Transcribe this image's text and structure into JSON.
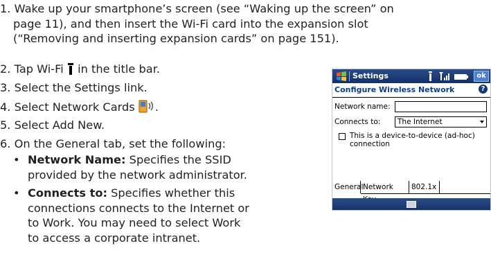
{
  "steps": [
    {
      "num": "1.",
      "text": "Wake up your smartphone’s screen (see “Waking up the screen” on",
      "line2": "page 11), and then insert the Wi-Fi card into the expansion slot",
      "line3": "(“Removing and inserting expansion cards” on page 151)."
    },
    {
      "num": "2.",
      "text_before": "Tap Wi-Fi",
      "text_after": "in the title bar.",
      "icon": "wifi-signal-icon"
    },
    {
      "num": "3.",
      "text": "Select the Settings link."
    },
    {
      "num": "4.",
      "text": "Select Network Cards",
      "icon": "network-cards-icon",
      "text_after": "."
    },
    {
      "num": "5.",
      "text": "Select Add New."
    },
    {
      "num": "6.",
      "text": "On the General tab, set the following:"
    }
  ],
  "bullets": [
    {
      "term": "Network Name:",
      "desc_l1": "Specifies the SSID",
      "desc_l2": "provided by the network administrator."
    },
    {
      "term": "Connects to:",
      "desc_l1": "Specifies whether this",
      "desc_l2": "connections connects to the Internet or",
      "desc_l3": "to Work. You may need to select Work",
      "desc_l4": "to access a corporate intranet."
    }
  ],
  "device": {
    "title": "Settings",
    "ok_label": "ok",
    "subheading": "Configure Wireless Network",
    "help_glyph": "?",
    "network_name_label": "Network name:",
    "network_name_value": "",
    "connects_to_label": "Connects to:",
    "connects_to_value": "The Internet",
    "adhoc_label": "This is a device-to-device (ad-hoc) connection",
    "adhoc_checked": false,
    "tabs": [
      "General",
      "Network Key",
      "802.1x"
    ],
    "active_tab": "General",
    "colors": {
      "titlebar": "#1d3b78",
      "heading": "#0b3d8c"
    }
  }
}
